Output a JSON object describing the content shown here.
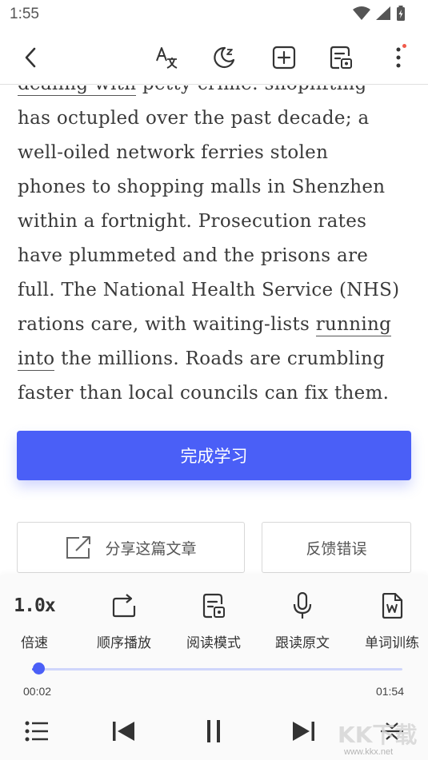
{
  "status_bar": {
    "time": "1:55"
  },
  "toolbar": {
    "back_icon": "back-icon",
    "translate_icon": "translate-icon",
    "night_mode_icon": "night-mode-icon",
    "add_icon": "add-icon",
    "reader_icon": "reader-mode-icon",
    "more_icon": "more-icon"
  },
  "article": {
    "line_0_a": "dealing with",
    "line_0_b": " petty crime: shoplifting",
    "line_1": "has octupled over the past decade; a",
    "line_2": "well-oiled network ferries stolen",
    "line_3": "phones to shopping malls in Shenzhen",
    "line_4": "within a fortnight. Prosecution rates",
    "line_5": "have plummeted and the prisons are",
    "line_6": "full. The National Health Service (NHS)",
    "line_7_a": "rations care, with waiting-lists ",
    "line_7_b": "running",
    "line_8_a": "into",
    "line_8_b": " the millions. Roads are crumbling",
    "line_9": "faster than local councils can fix them."
  },
  "actions": {
    "finish_label": "完成学习",
    "share_label": "分享这篇文章",
    "feedback_label": "反馈错误"
  },
  "player": {
    "speed_value": "1.0x",
    "speed_label": "倍速",
    "order_label": "顺序播放",
    "reader_label": "阅读模式",
    "follow_label": "跟读原文",
    "vocab_label": "单词训练",
    "current_time": "00:02",
    "total_time": "01:54",
    "progress": 0.018
  },
  "watermark": {
    "text": "KK下载",
    "url": "www.kkx.net"
  },
  "colors": {
    "accent": "#4a5ff7",
    "track": "#cfd6fb",
    "dot": "#f05a4a"
  }
}
